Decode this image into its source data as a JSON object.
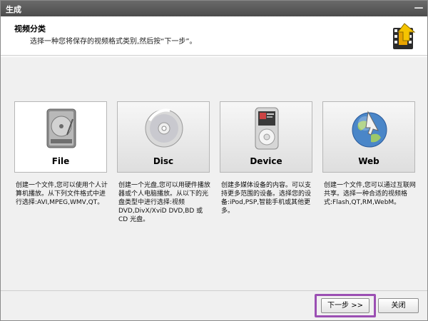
{
  "window": {
    "title": "生成",
    "close_glyph": "—"
  },
  "header": {
    "title": "视频分类",
    "subtitle": "选择一种您将保存的视频格式类别,然后按“下一步”。",
    "logo_icon": "film-arrow-icon"
  },
  "options": [
    {
      "label": "File",
      "icon": "hard-drive-icon",
      "selected": true,
      "description": "创建一个文件,您可以使用个人计算机播放。从下列文件格式中进行选择:AVI,MPEG,WMV,QT。"
    },
    {
      "label": "Disc",
      "icon": "disc-icon",
      "selected": false,
      "description": "创建一个光盘,您可以用硬件播放器或个人电脑播放。从以下的光盘类型中进行选择:视频 DVD,DivX/XviD DVD,BD 或 CD 光盘。"
    },
    {
      "label": "Device",
      "icon": "media-player-icon",
      "selected": false,
      "description": "创建多媒体设备的内容。可以支持更多范围的设备。选择您的设备:iPod,PSP,智能手机或其他更多。"
    },
    {
      "label": "Web",
      "icon": "globe-icon",
      "selected": false,
      "description": "创建一个文件,您可以通过互联网共享。选择一种合适的视频格式:Flash,QT,RM,WebM。"
    }
  ],
  "footer": {
    "next_label": "下一步 >>",
    "close_label": "关闭"
  },
  "colors": {
    "highlight": "#9b4fb3",
    "titlebar": "#555555"
  }
}
